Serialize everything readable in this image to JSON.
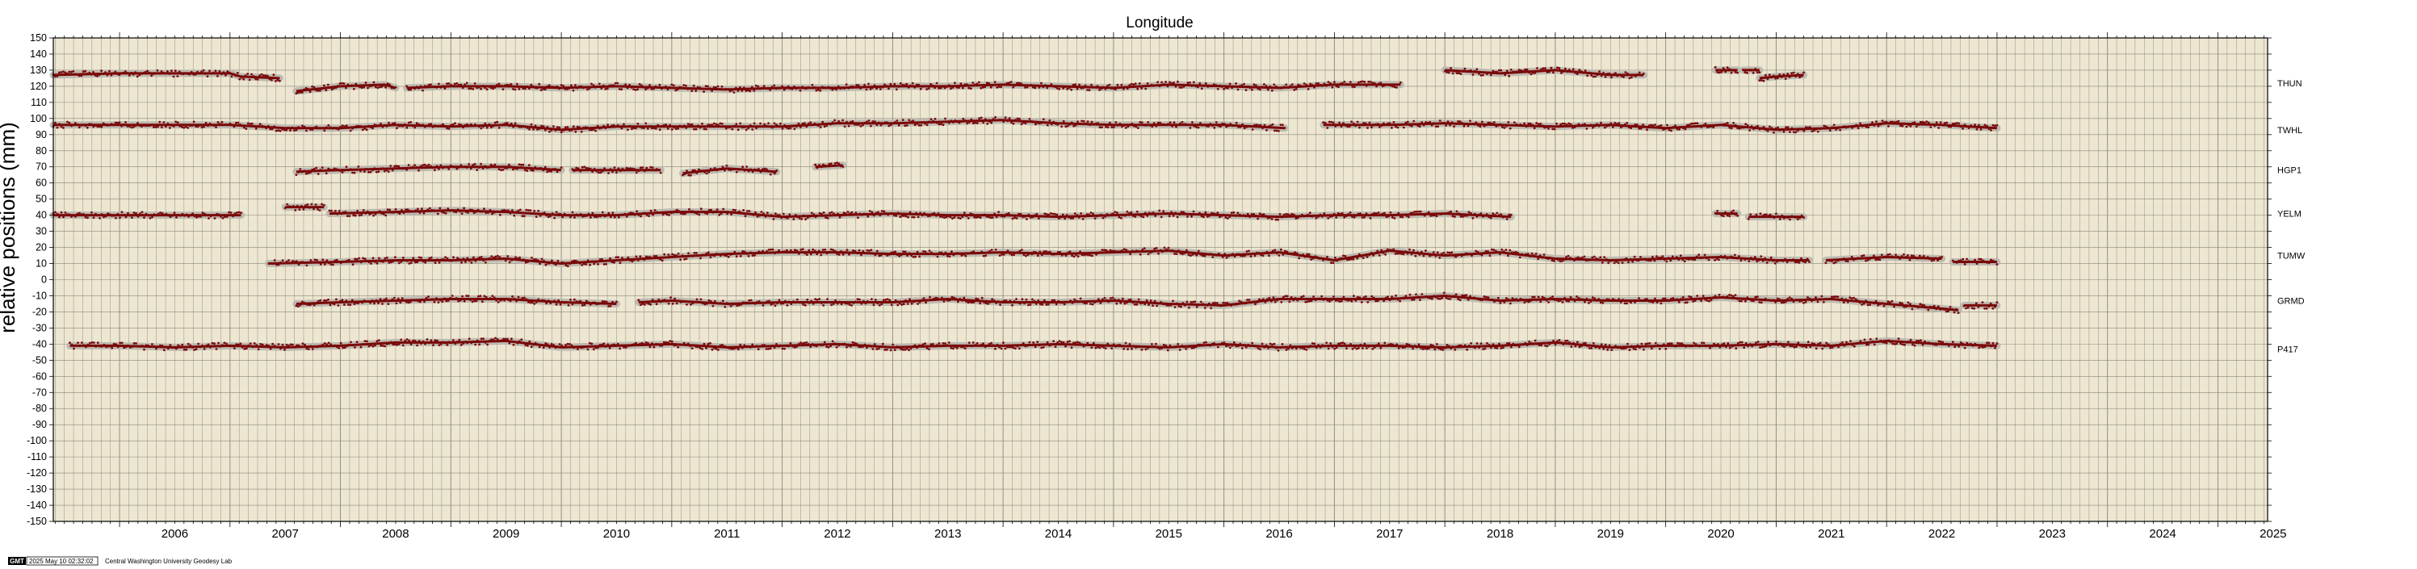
{
  "chart_data": {
    "type": "scatter",
    "title": "Longitude",
    "ylabel": "relative positions (mm)",
    "xlabel": "",
    "xlim": [
      2005.4,
      2025.45
    ],
    "ylim": [
      -150,
      150
    ],
    "ytick_step": 10,
    "x_ticks": [
      "2006",
      "2007",
      "2008",
      "2009",
      "2010",
      "2011",
      "2012",
      "2013",
      "2014",
      "2015",
      "2016",
      "2017",
      "2018",
      "2019",
      "2020",
      "2021",
      "2022",
      "2023",
      "2024",
      "2025"
    ],
    "grid": true,
    "colors": {
      "points": "#7a0a0a",
      "band": "#b8b6ae",
      "plot_bg": "#ede6d1",
      "grid": "#8a877a"
    },
    "series": [
      {
        "name": "THUN",
        "label_y": 122,
        "segments": [
          {
            "x": [
              2005.4,
              2006.0,
              2006.6,
              2007.0,
              2007.1,
              2007.45
            ],
            "y": [
              127,
              128,
              128,
              128,
              126,
              125
            ]
          },
          {
            "x": [
              2007.6,
              2008.0,
              2008.4,
              2008.5
            ],
            "y": [
              117,
              120,
              121,
              119
            ]
          },
          {
            "x": [
              2008.6,
              2009.0,
              2009.5,
              2010.0,
              2010.5,
              2011.0,
              2011.5,
              2012.0,
              2012.5,
              2013.0,
              2013.5,
              2014.0,
              2014.5,
              2015.0,
              2015.5,
              2016.0,
              2016.5,
              2017.0,
              2017.6
            ],
            "y": [
              119,
              120,
              120,
              119,
              120,
              119,
              118,
              119,
              119,
              120,
              120,
              121,
              120,
              119,
              121,
              120,
              119,
              121,
              121
            ]
          },
          {
            "x": [
              2018.0,
              2018.5,
              2019.0,
              2019.5,
              2019.8
            ],
            "y": [
              130,
              128,
              130,
              127,
              127
            ]
          },
          {
            "x": [
              2020.45,
              2020.65
            ],
            "y": [
              130,
              130
            ]
          },
          {
            "x": [
              2020.7,
              2020.85
            ],
            "y": [
              130,
              130
            ]
          },
          {
            "x": [
              2020.85,
              2021.0,
              2021.25
            ],
            "y": [
              125,
              126,
              127
            ]
          }
        ]
      },
      {
        "name": "TWHL",
        "label_y": 93,
        "segments": [
          {
            "x": [
              2005.4,
              2006.0,
              2006.5,
              2007.0,
              2007.5,
              2008.0,
              2008.5,
              2009.0,
              2009.5,
              2010.0,
              2010.5,
              2011.0,
              2011.5,
              2012.0,
              2012.5,
              2013.0,
              2013.5,
              2014.0,
              2014.5,
              2015.0,
              2015.5,
              2016.0,
              2016.55
            ],
            "y": [
              96,
              96,
              96,
              96,
              94,
              94,
              96,
              95,
              96,
              93,
              95,
              95,
              95,
              95,
              97,
              97,
              98,
              99,
              97,
              96,
              96,
              96,
              94
            ]
          },
          {
            "x": [
              2016.9,
              2017.5,
              2018.0,
              2018.5,
              2019.0,
              2019.5,
              2020.0,
              2020.5,
              2021.0,
              2021.5,
              2022.0,
              2022.5,
              2023.0
            ],
            "y": [
              96,
              96,
              97,
              96,
              95,
              96,
              94,
              96,
              93,
              94,
              97,
              96,
              94
            ]
          }
        ]
      },
      {
        "name": "HGP1",
        "label_y": 68,
        "segments": [
          {
            "x": [
              2007.6,
              2008.0,
              2008.5,
              2009.0,
              2009.5,
              2010.0
            ],
            "y": [
              67,
              68,
              69,
              70,
              70,
              68
            ]
          },
          {
            "x": [
              2010.1,
              2010.5,
              2010.9
            ],
            "y": [
              68,
              68,
              68
            ]
          },
          {
            "x": [
              2011.1,
              2011.5,
              2011.95
            ],
            "y": [
              66,
              69,
              67
            ]
          },
          {
            "x": [
              2012.3,
              2012.55
            ],
            "y": [
              70,
              71
            ]
          }
        ]
      },
      {
        "name": "YELM",
        "label_y": 41,
        "segments": [
          {
            "x": [
              2005.4,
              2006.0,
              2006.5,
              2007.1
            ],
            "y": [
              40,
              40,
              40,
              40
            ]
          },
          {
            "x": [
              2007.5,
              2007.85
            ],
            "y": [
              45,
              45
            ]
          },
          {
            "x": [
              2007.9,
              2008.5,
              2009.0,
              2009.5,
              2010.0,
              2010.5,
              2011.0,
              2011.5,
              2012.0,
              2012.5,
              2013.0,
              2013.5,
              2014.0,
              2014.5,
              2015.0,
              2015.5,
              2016.0,
              2016.5,
              2017.0,
              2017.5,
              2018.0,
              2018.6
            ],
            "y": [
              41,
              42,
              43,
              42,
              40,
              40,
              42,
              42,
              39,
              40,
              41,
              40,
              40,
              39,
              40,
              41,
              40,
              39,
              40,
              40,
              41,
              39
            ]
          },
          {
            "x": [
              2020.45,
              2020.65
            ],
            "y": [
              41,
              41
            ]
          },
          {
            "x": [
              2020.75,
              2021.25
            ],
            "y": [
              39,
              39
            ]
          }
        ]
      },
      {
        "name": "TUMW",
        "label_y": 15,
        "segments": [
          {
            "x": [
              2007.35,
              2008.0,
              2008.5,
              2009.0,
              2009.5,
              2010.0,
              2010.5,
              2011.0,
              2011.5,
              2012.0,
              2012.5,
              2013.0,
              2013.5,
              2014.0,
              2014.5,
              2015.0,
              2015.5,
              2016.0,
              2016.5,
              2017.0,
              2017.5,
              2018.0,
              2018.5,
              2019.0,
              2019.5,
              2020.0,
              2020.5,
              2021.0,
              2021.3
            ],
            "y": [
              10,
              11,
              12,
              12,
              13,
              10,
              12,
              14,
              16,
              17,
              17,
              16,
              16,
              17,
              16,
              17,
              18,
              15,
              17,
              12,
              18,
              15,
              17,
              13,
              12,
              13,
              14,
              12,
              12
            ]
          },
          {
            "x": [
              2021.45,
              2022.0,
              2022.5
            ],
            "y": [
              12,
              14,
              13
            ]
          },
          {
            "x": [
              2022.6,
              2023.0
            ],
            "y": [
              11,
              11
            ]
          }
        ]
      },
      {
        "name": "GRMD",
        "label_y": -13,
        "segments": [
          {
            "x": [
              2007.6,
              2008.0,
              2008.5,
              2009.0,
              2009.5,
              2010.0,
              2010.5
            ],
            "y": [
              -15,
              -14,
              -13,
              -12,
              -12,
              -14,
              -15
            ]
          },
          {
            "x": [
              2010.7,
              2011.0,
              2011.5,
              2012.0,
              2012.5,
              2013.0,
              2013.5,
              2014.0,
              2014.5,
              2015.0,
              2015.5,
              2016.0,
              2016.5,
              2017.0,
              2017.5,
              2018.0,
              2018.5,
              2019.0,
              2019.5,
              2020.0,
              2020.5,
              2021.0,
              2021.5,
              2022.0,
              2022.5,
              2022.65
            ],
            "y": [
              -14,
              -13,
              -15,
              -14,
              -14,
              -14,
              -12,
              -14,
              -14,
              -13,
              -15,
              -16,
              -12,
              -12,
              -12,
              -10,
              -13,
              -12,
              -13,
              -13,
              -11,
              -13,
              -12,
              -15,
              -18,
              -19
            ]
          },
          {
            "x": [
              2022.7,
              2023.0
            ],
            "y": [
              -16,
              -16
            ]
          }
        ]
      },
      {
        "name": "P417",
        "label_y": -43,
        "segments": [
          {
            "x": [
              2005.55,
              2006.0,
              2006.5,
              2007.0,
              2007.5,
              2008.0,
              2008.5,
              2009.0,
              2009.5,
              2010.0,
              2010.5,
              2011.0,
              2011.5,
              2012.0,
              2012.5,
              2013.0,
              2013.5,
              2014.0,
              2014.5,
              2015.0,
              2015.5,
              2016.0,
              2016.5,
              2017.0,
              2017.5,
              2018.0,
              2018.5,
              2019.0,
              2019.5,
              2020.0,
              2020.5,
              2021.0,
              2021.5,
              2022.0,
              2022.5,
              2023.0
            ],
            "y": [
              -41,
              -41,
              -42,
              -41,
              -42,
              -41,
              -39,
              -39,
              -38,
              -42,
              -41,
              -40,
              -42,
              -41,
              -40,
              -42,
              -41,
              -41,
              -40,
              -41,
              -42,
              -40,
              -42,
              -41,
              -41,
              -42,
              -41,
              -39,
              -42,
              -41,
              -41,
              -40,
              -41,
              -38,
              -40,
              -41
            ]
          }
        ]
      }
    ]
  },
  "footer": {
    "gmt_badge": "GMT",
    "timestamp": "2025 May 10 02:32:02",
    "credit": "Central Washington University Geodesy Lab"
  }
}
